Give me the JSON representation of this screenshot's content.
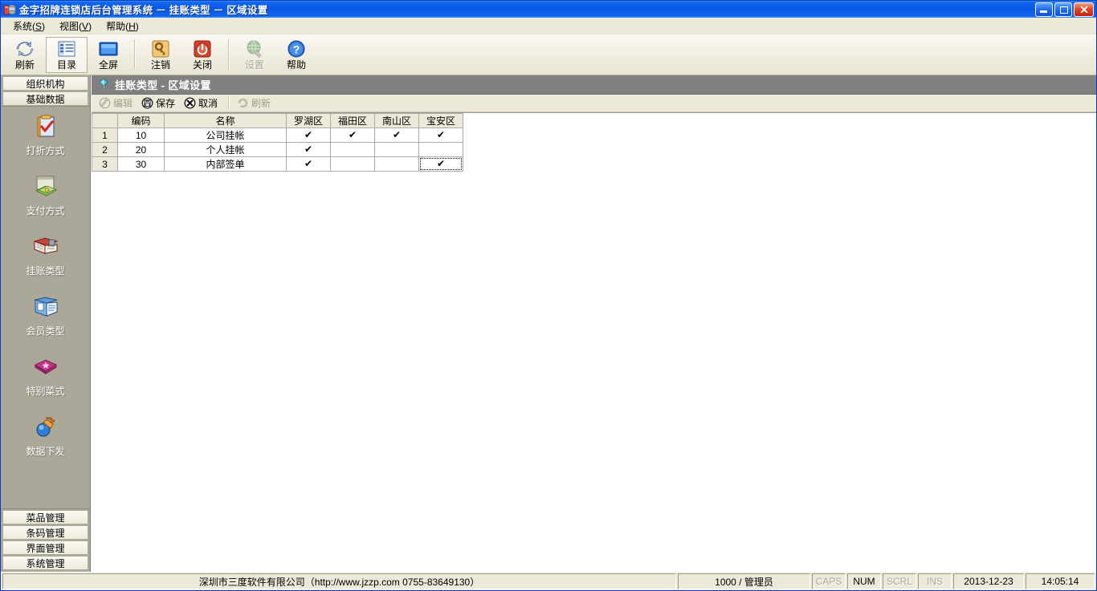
{
  "window": {
    "title": "金字招牌连锁店后台管理系统  －  挂账类型  －  区域设置",
    "icon": "application-icon",
    "minimize_label": "最小化",
    "maximize_label": "最大化",
    "close_label": "关闭",
    "close_glyph": "✕"
  },
  "menubar": {
    "items": [
      {
        "name": "menu-system",
        "text": "系统",
        "accel": "S"
      },
      {
        "name": "menu-view",
        "text": "视图",
        "accel": "V"
      },
      {
        "name": "menu-help",
        "text": "帮助",
        "accel": "H"
      }
    ]
  },
  "toolbar": {
    "buttons": [
      {
        "label": "刷新",
        "icon": "refresh-icon",
        "disabled": false,
        "selected": false
      },
      {
        "label": "目录",
        "icon": "catalog-icon",
        "disabled": false,
        "selected": true
      },
      {
        "label": "全屏",
        "icon": "fullscreen-icon",
        "disabled": false,
        "selected": false
      },
      {
        "label": "注销",
        "icon": "logout-key-icon",
        "disabled": false,
        "selected": false
      },
      {
        "label": "关闭",
        "icon": "shutdown-icon",
        "disabled": false,
        "selected": false
      },
      {
        "label": "设置",
        "icon": "settings-globe-icon",
        "disabled": true,
        "selected": false
      },
      {
        "label": "帮助",
        "icon": "help-question-icon",
        "disabled": false,
        "selected": false
      }
    ]
  },
  "sidebar": {
    "top_groups": [
      {
        "label": "组织机构",
        "active": false
      },
      {
        "label": "基础数据",
        "active": true
      }
    ],
    "items": [
      {
        "label": "打折方式",
        "icon": "clipboard-check-icon"
      },
      {
        "label": "支付方式",
        "icon": "cash-money-icon"
      },
      {
        "label": "挂账类型",
        "icon": "ledger-book-icon"
      },
      {
        "label": "会员类型",
        "icon": "member-card-icon"
      },
      {
        "label": "特别菜式",
        "icon": "special-dish-icon"
      },
      {
        "label": "数据下发",
        "icon": "data-dispatch-icon"
      }
    ],
    "bottom_groups": [
      {
        "label": "菜品管理"
      },
      {
        "label": "条码管理"
      },
      {
        "label": "界面管理"
      },
      {
        "label": "系统管理"
      }
    ]
  },
  "content": {
    "header": {
      "icon": "gem-icon",
      "title": "挂账类型 - 区域设置"
    },
    "actionbar": [
      {
        "label": "编辑",
        "icon": "edit-pen-icon",
        "disabled": true
      },
      {
        "label": "保存",
        "icon": "save-disk-icon",
        "disabled": false
      },
      {
        "label": "取消",
        "icon": "cancel-x-icon",
        "disabled": false
      },
      {
        "label": "刷新",
        "icon": "refresh-small-icon",
        "disabled": true
      }
    ],
    "grid": {
      "columns": [
        {
          "key": "rowno",
          "label": "",
          "type": "rowheader"
        },
        {
          "key": "code",
          "label": "编码",
          "type": "text"
        },
        {
          "key": "name",
          "label": "名称",
          "type": "text"
        },
        {
          "key": "luohu",
          "label": "罗湖区",
          "type": "check"
        },
        {
          "key": "futian",
          "label": "福田区",
          "type": "check"
        },
        {
          "key": "nanshan",
          "label": "南山区",
          "type": "check"
        },
        {
          "key": "baoan",
          "label": "宝安区",
          "type": "check"
        }
      ],
      "check_glyph": "✔",
      "rows": [
        {
          "rowno": "1",
          "code": "10",
          "name": "公司挂帐",
          "luohu": true,
          "futian": true,
          "nanshan": true,
          "baoan": true,
          "focus": ""
        },
        {
          "rowno": "2",
          "code": "20",
          "name": "个人挂帐",
          "luohu": true,
          "futian": false,
          "nanshan": false,
          "baoan": false,
          "focus": ""
        },
        {
          "rowno": "3",
          "code": "30",
          "name": "内部签单",
          "luohu": true,
          "futian": false,
          "nanshan": false,
          "baoan": true,
          "focus": "baoan"
        }
      ]
    }
  },
  "statusbar": {
    "copyright": "深圳市三度软件有限公司（http://www.jzzp.com  0755-83649130）",
    "user": "1000 / 管理员",
    "keys": [
      {
        "label": "CAPS",
        "active": false
      },
      {
        "label": "NUM",
        "active": true
      },
      {
        "label": "SCRL",
        "active": false
      },
      {
        "label": "INS",
        "active": false
      }
    ],
    "date": "2013-12-23",
    "time": "14:05:14"
  },
  "colors": {
    "titlebar_blue": "#0a58e8",
    "sidebar_gray": "#aca899",
    "panel_beige": "#ece9d8",
    "content_header_gray": "#808080",
    "face": "#d4d0c8"
  }
}
